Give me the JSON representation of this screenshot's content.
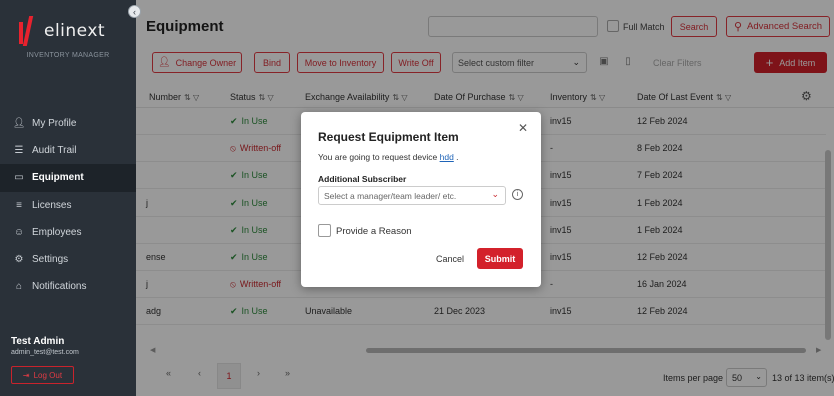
{
  "brand": {
    "name": "elinext",
    "subtitle": "INVENTORY MANAGER",
    "accent": "#d3212b"
  },
  "sidebar": {
    "items": [
      {
        "label": "My Profile",
        "icon": "user-icon"
      },
      {
        "label": "Audit Trail",
        "icon": "document-icon"
      },
      {
        "label": "Equipment",
        "icon": "monitor-icon",
        "active": true
      },
      {
        "label": "Licenses",
        "icon": "list-icon"
      },
      {
        "label": "Employees",
        "icon": "people-icon"
      },
      {
        "label": "Settings",
        "icon": "gear-icon"
      },
      {
        "label": "Notifications",
        "icon": "bell-icon"
      }
    ],
    "user": {
      "name": "Test Admin",
      "email": "admin_test@test.com"
    },
    "logout_label": "Log Out"
  },
  "header": {
    "title": "Equipment",
    "search_value": "",
    "full_match_label": "Full Match",
    "search_label": "Search",
    "advanced_search_label": "Advanced Search"
  },
  "toolbar": {
    "change_owner": "Change Owner",
    "bind": "Bind",
    "move_to_inventory": "Move to Inventory",
    "write_off": "Write Off",
    "custom_filter_placeholder": "Select custom filter",
    "clear_filters": "Clear Filters",
    "add_item": "Add Item"
  },
  "table": {
    "columns": [
      "Number",
      "Status",
      "Exchange Availability",
      "Date Of Purchase",
      "Inventory",
      "Date Of Last Event"
    ],
    "rows": [
      {
        "number": "",
        "status": "In Use",
        "status_type": "ok",
        "exchange": "",
        "purchase": "",
        "inventory": "inv15",
        "last_event": "12 Feb 2024"
      },
      {
        "number": "",
        "status": "Written-off",
        "status_type": "off",
        "exchange": "",
        "purchase": "",
        "inventory": "-",
        "last_event": "8 Feb 2024"
      },
      {
        "number": "",
        "status": "In Use",
        "status_type": "ok",
        "exchange": "",
        "purchase": "",
        "inventory": "inv15",
        "last_event": "7 Feb 2024"
      },
      {
        "number": "j",
        "status": "In Use",
        "status_type": "ok",
        "exchange": "",
        "purchase": "",
        "inventory": "inv15",
        "last_event": "1 Feb 2024"
      },
      {
        "number": "",
        "status": "In Use",
        "status_type": "ok",
        "exchange": "",
        "purchase": "",
        "inventory": "inv15",
        "last_event": "1 Feb 2024"
      },
      {
        "number": "ense",
        "status": "In Use",
        "status_type": "ok",
        "exchange": "",
        "purchase": "",
        "inventory": "inv15",
        "last_event": "12 Feb 2024"
      },
      {
        "number": "j",
        "status": "Written-off",
        "status_type": "off",
        "exchange": "Unavailable",
        "purchase": "6 Dec 2023",
        "inventory": "-",
        "last_event": "16 Jan 2024"
      },
      {
        "number": "adg",
        "status": "In Use",
        "status_type": "ok",
        "exchange": "Unavailable",
        "purchase": "21 Dec 2023",
        "inventory": "inv15",
        "last_event": "12 Feb 2024"
      }
    ]
  },
  "pagination": {
    "first": "«",
    "prev": "‹",
    "current_page": "1",
    "next": "›",
    "last": "»",
    "items_per_page_label": "Items per page",
    "items_per_page_value": "50",
    "count_text": "13 of 13 item(s)"
  },
  "modal": {
    "title": "Request Equipment Item",
    "description_prefix": "You are going to request device ",
    "device_link": "hdd",
    "description_suffix": " .",
    "subscriber_label": "Additional Subscriber",
    "subscriber_placeholder": "Select a manager/team leader/ etc.",
    "reason_label": "Provide a Reason",
    "cancel_label": "Cancel",
    "submit_label": "Submit"
  }
}
